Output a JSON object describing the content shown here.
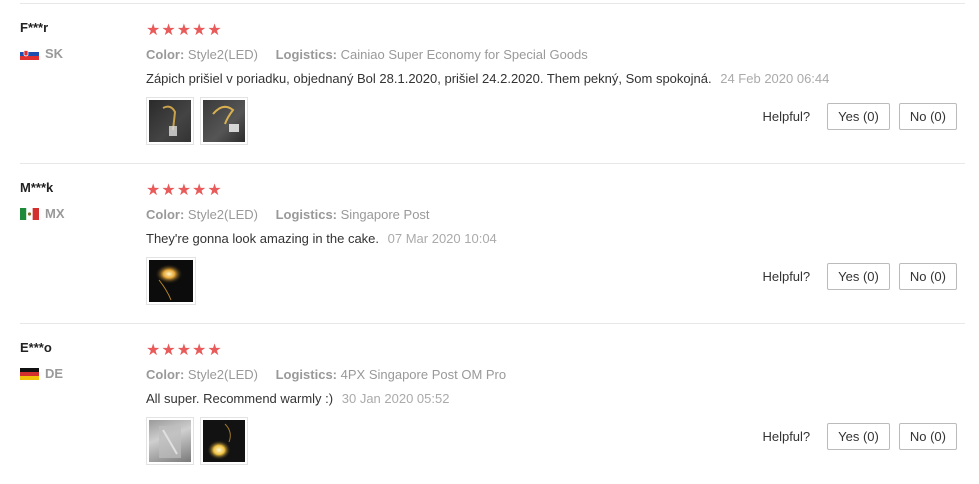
{
  "labels": {
    "color": "Color:",
    "logistics": "Logistics:",
    "helpful": "Helpful?"
  },
  "reviews": [
    {
      "user": "F***r",
      "country": "SK",
      "stars": "★★★★★",
      "color": "Style2(LED)",
      "logistics": "Cainiao Super Economy for Special Goods",
      "text": "Zápich prišiel v poriadku, objednaný Bol 28.1.2020, prišiel 24.2.2020. Them pekný, Som spokojná.",
      "date": "24 Feb 2020 06:44",
      "yes": "Yes (0)",
      "no": "No (0)"
    },
    {
      "user": "M***k",
      "country": "MX",
      "stars": "★★★★★",
      "color": "Style2(LED)",
      "logistics": "Singapore Post",
      "text": "They're gonna look amazing in the cake.",
      "date": "07 Mar 2020 10:04",
      "yes": "Yes (0)",
      "no": "No (0)"
    },
    {
      "user": "E***o",
      "country": "DE",
      "stars": "★★★★★",
      "color": "Style2(LED)",
      "logistics": "4PX Singapore Post OM Pro",
      "text": "All super. Recommend warmly :)",
      "date": "30 Jan 2020 05:52",
      "yes": "Yes (0)",
      "no": "No (0)"
    }
  ],
  "colors": {
    "star": "#e95a5a",
    "muted": "#999999",
    "border": "#e8e8e8"
  }
}
